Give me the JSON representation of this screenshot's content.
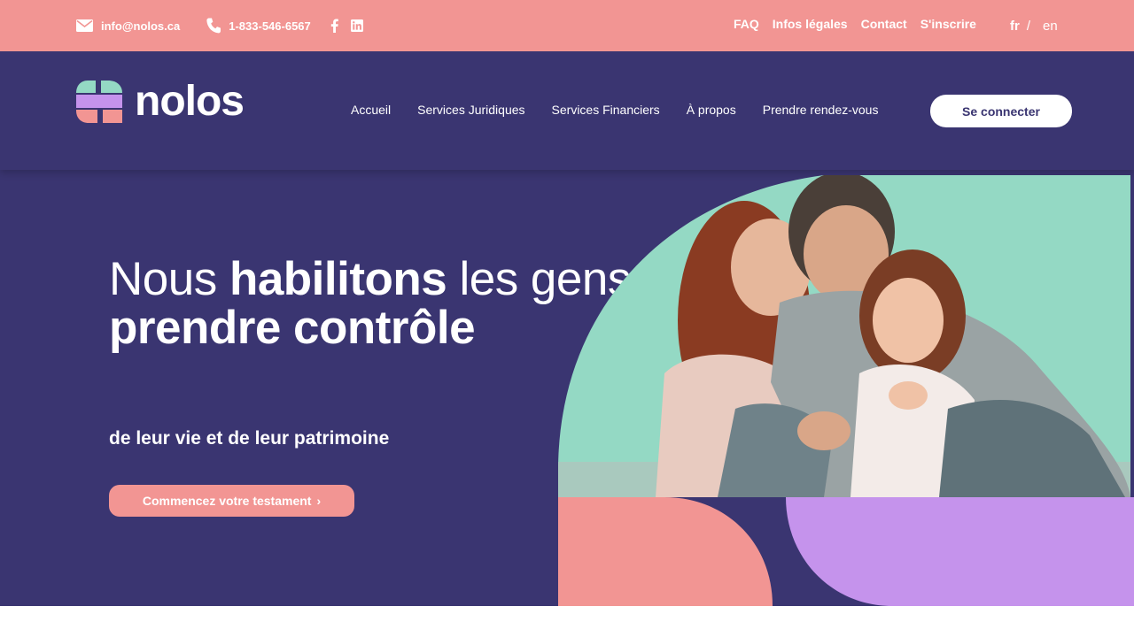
{
  "topbar": {
    "email": "info@nolos.ca",
    "phone": "1-833-546-6567",
    "links": [
      "FAQ",
      "Infos légales",
      "Contact",
      "S'inscrire"
    ],
    "lang": {
      "fr": "fr",
      "sep": "/",
      "en": "en"
    }
  },
  "header": {
    "logo_text": "nolos",
    "nav": [
      "Accueil",
      "Services Juridiques",
      "Services Financiers",
      "À propos",
      "Prendre rendez-vous"
    ],
    "login_label": "Se connecter"
  },
  "hero": {
    "headline": {
      "part1": "Nous ",
      "bold1": "habilitons",
      "part2": " les gens comme vous à ",
      "bold2": "prendre contrôle"
    },
    "subline": "de leur vie et de leur patrimoine",
    "cta_label": "Commencez votre testament",
    "cta_chevron": "›"
  },
  "icons": {
    "email": "envelope-icon",
    "phone": "phone-icon",
    "facebook": "facebook-icon",
    "linkedin": "linkedin-icon"
  },
  "colors": {
    "topbar": "#f29593",
    "navy": "#3a3571",
    "mint": "#94d9c4",
    "pink": "#f29593",
    "lavender": "#c593ec",
    "white": "#ffffff"
  }
}
